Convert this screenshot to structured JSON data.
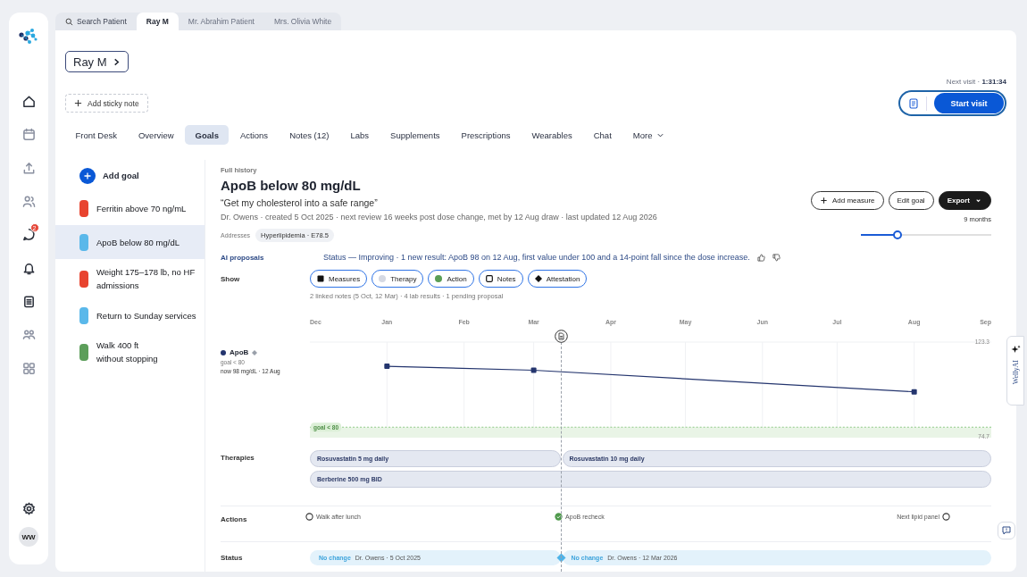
{
  "rail": {
    "badge": "2",
    "avatar": "WW"
  },
  "patient_tabs": [
    {
      "label": "Search Patient",
      "kind": "search",
      "selected": false
    },
    {
      "label": "Ray M",
      "kind": "patient",
      "selected": true
    },
    {
      "label": "Mr. Abrahim Patient",
      "kind": "patient",
      "selected": false
    },
    {
      "label": "Mrs. Olivia White",
      "kind": "patient",
      "selected": false
    }
  ],
  "patient": {
    "name": "Ray M"
  },
  "sticky_note": "Add sticky note",
  "next_visit": "Next visit · **1:31:34**",
  "start_visit": "Start visit",
  "nav_tabs": [
    {
      "label": "Front Desk",
      "selected": false
    },
    {
      "label": "Overview",
      "selected": false
    },
    {
      "label": "Goals",
      "selected": true
    },
    {
      "label": "Actions",
      "selected": false
    },
    {
      "label": "Notes (12)",
      "selected": false
    },
    {
      "label": "Labs",
      "selected": false
    },
    {
      "label": "Supplements",
      "selected": false
    },
    {
      "label": "Prescriptions",
      "selected": false
    },
    {
      "label": "Wearables",
      "selected": false
    },
    {
      "label": "Chat",
      "selected": false
    },
    {
      "label": "More",
      "selected": false,
      "kind": "dropdown"
    }
  ],
  "goals": {
    "add": "Add goal",
    "items": [
      {
        "label": "Ferritin above 70 ng/mL",
        "color": "#e8432f",
        "selected": false
      },
      {
        "label": "ApoB below 80 mg/dL",
        "color": "#5ab8ea",
        "selected": true
      },
      {
        "label": "Weight 175–178 lb, no HF admissions",
        "color": "#e8432f",
        "selected": false
      },
      {
        "label": "Return to Sunday services",
        "color": "#5ab8ea",
        "selected": false
      },
      {
        "label": "Walk 400 ft\nwithout stopping",
        "color": "#5c9e5a",
        "selected": false
      }
    ]
  },
  "detail": {
    "eyebrow": "Full history",
    "title": "ApoB below 80 mg/dL",
    "quote": "“Get my cholesterol into a safe range”",
    "meta": "Dr. Owens · created 5 Oct 2025 · next review 16 weeks post dose change, met by 12 Aug draw · last updated 12 Aug 2026",
    "addresses_label": "Addresses",
    "addresses": [
      "Hyperlipidemia · E78.5"
    ],
    "buttons": [
      {
        "label": "Add measure",
        "kind": "add"
      },
      {
        "label": "Edit goal",
        "kind": "outline"
      },
      {
        "label": "Export",
        "kind": "menu"
      }
    ],
    "range": {
      "label": "9 months",
      "level": 0.28
    }
  },
  "ai_proposals": {
    "label": "AI proposals",
    "text": "Status — Improving · 1 new result: ApoB 98 on 12 Aug, first value under 100 and a 14-point fall since the dose increase."
  },
  "show": {
    "label": "Show",
    "filters": [
      {
        "label": "Measures",
        "kind": "square",
        "on": true
      },
      {
        "label": "Therapy",
        "kind": "therapy",
        "on": true
      },
      {
        "label": "Action",
        "kind": "action",
        "on": true
      },
      {
        "label": "Notes",
        "kind": "note",
        "on": true
      },
      {
        "label": "Attestation",
        "kind": "diamond",
        "on": true
      }
    ]
  },
  "summary": "2 linked notes (5 Oct, 12 Mar) · 4 lab results · 1 pending proposal",
  "measure": {
    "goal": "goal < 80",
    "now": "now 98 mg/dL · 12 Aug",
    "chart_data": {
      "type": "line",
      "grid": true,
      "categories": [
        "Dec",
        "Jan",
        "Feb",
        "Mar",
        "Apr",
        "May",
        "Jun",
        "Jul",
        "Aug",
        "Sep"
      ],
      "ylim": [
        74.7,
        123.3
      ],
      "yticks": [
        74.7,
        123.3
      ],
      "series": [
        {
          "name": "ApoB",
          "color": "#24356e",
          "marker": "square",
          "values": [
            null,
            111,
            null,
            109,
            null,
            null,
            null,
            null,
            98,
            null
          ]
        }
      ],
      "ref_lines": [
        {
          "axis": "y",
          "value": 80,
          "label": "goal < 80"
        }
      ]
    }
  },
  "therapies": {
    "label": "Therapies",
    "rows": [
      {
        "bars": [
          "Rosuvastatin 5 mg daily",
          "Rosuvastatin 10 mg daily"
        ]
      },
      {
        "bars": [
          "Berberine 500 mg BID"
        ]
      }
    ]
  },
  "actions": {
    "label": "Actions",
    "items": [
      {
        "label": "Walk after lunch",
        "done": false
      },
      {
        "label": "ApoB recheck",
        "done": true
      },
      {
        "label": "Next lipid panel",
        "done": false
      }
    ]
  },
  "status": {
    "label": "Status",
    "items": [
      {
        "status": "No change",
        "by": "Dr. Owens · 5 Oct 2025"
      },
      {
        "status": "No change",
        "by": "Dr. Owens · 12 Mar 2026"
      }
    ]
  },
  "assistant": {
    "label": "WellyAI"
  }
}
